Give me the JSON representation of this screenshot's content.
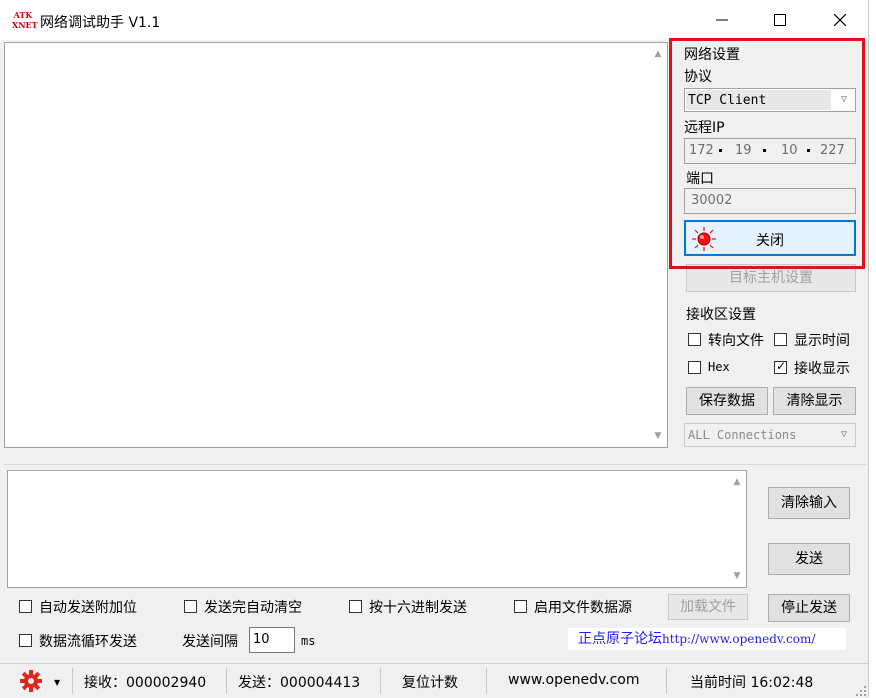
{
  "window": {
    "title": "网络调试助手 V1.1",
    "logo_text_top": "ATK",
    "logo_text_bottom": "XNET"
  },
  "network": {
    "group_label": "网络设置",
    "protocol_label": "协议",
    "protocol_value": "TCP Client",
    "remote_ip_label": "远程IP",
    "ip_octets": [
      "172",
      "19",
      "10",
      "227"
    ],
    "port_label": "端口",
    "port_value": "30002",
    "connect_button_label": "关闭",
    "host_settings_label": "目标主机设置",
    "highlight_color": "#e0111a"
  },
  "receive": {
    "group_label": "接收区设置",
    "to_file_label": "转向文件",
    "to_file_checked": false,
    "show_time_label": "显示时间",
    "show_time_checked": false,
    "hex_label": "Hex",
    "hex_checked": false,
    "show_recv_label": "接收显示",
    "show_recv_checked": true,
    "save_button": "保存数据",
    "clear_button": "清除显示",
    "connections_value": "ALL Connections"
  },
  "send": {
    "clear_input_button": "清除输入",
    "send_button": "发送",
    "stop_send_button": "停止发送",
    "load_file_button": "加载文件",
    "opt_auto_append": "自动发送附加位",
    "opt_auto_clear": "发送完自动清空",
    "opt_hex_send": "按十六进制发送",
    "opt_file_source": "启用文件数据源",
    "opt_loop_send": "数据流循环发送",
    "interval_label": "发送间隔",
    "interval_value": "10",
    "interval_unit": "ms",
    "forum_link_text": "正点原子论坛",
    "forum_link_url": "http://www.openedv.com/"
  },
  "statusbar": {
    "received": "接收：000002940",
    "sent": "发送：000004413",
    "reset_label": "复位计数",
    "website": "www.openedv.com",
    "current_time": "当前时间 16:02:48"
  }
}
